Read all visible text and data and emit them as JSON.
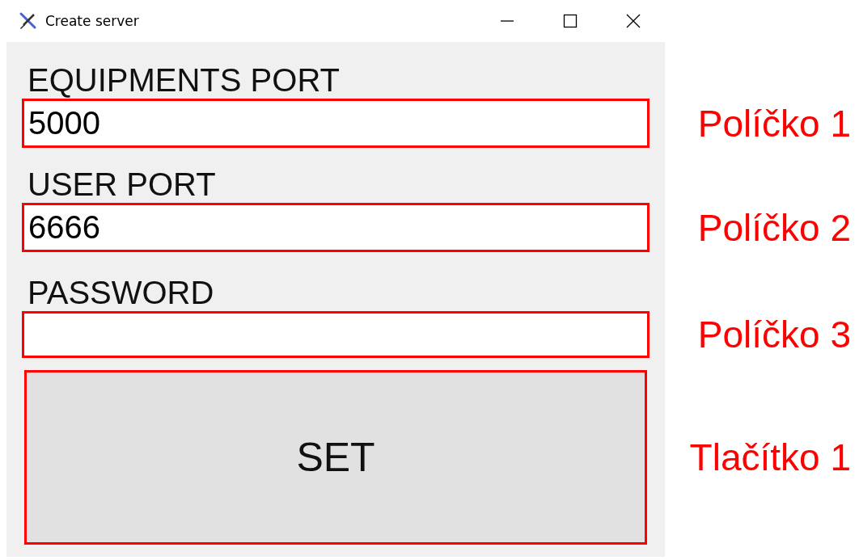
{
  "window": {
    "title": "Create server"
  },
  "fields": [
    {
      "label": "EQUIPMENTS PORT",
      "value": "5000",
      "annotation": "Políčko 1"
    },
    {
      "label": "USER PORT",
      "value": "6666",
      "annotation": "Políčko 2"
    },
    {
      "label": "PASSWORD",
      "annotation": "Políčko 3"
    }
  ],
  "button": {
    "label": "SET",
    "annotation": "Tlačítko 1"
  }
}
